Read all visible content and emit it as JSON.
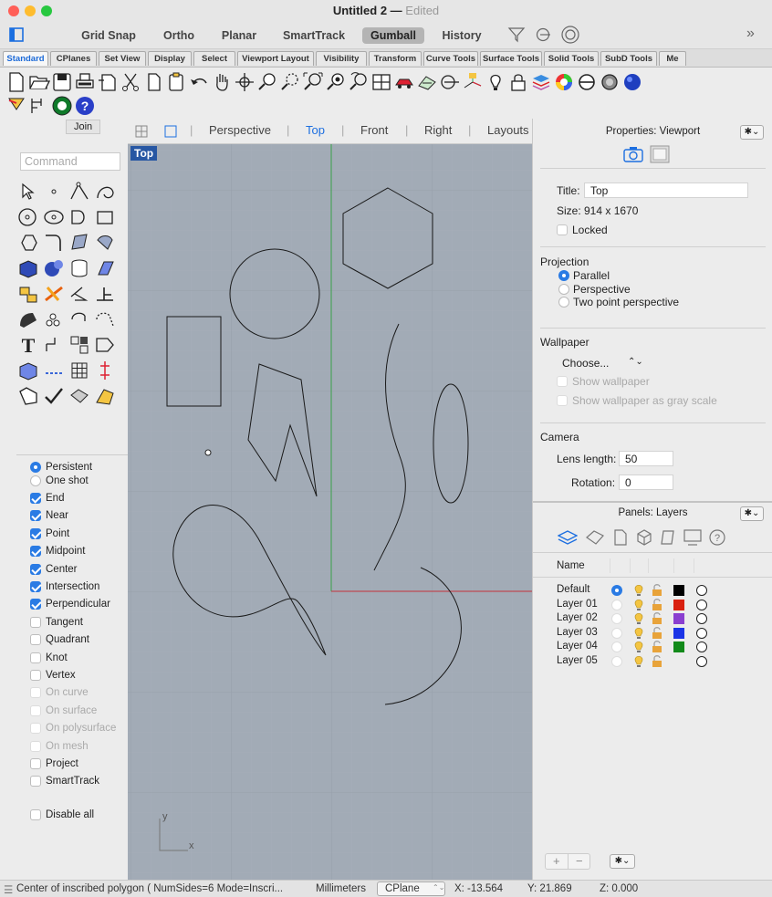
{
  "window": {
    "title": "Untitled 2",
    "edited": "Edited"
  },
  "modes": [
    "Grid Snap",
    "Ortho",
    "Planar",
    "SmartTrack",
    "Gumball",
    "History"
  ],
  "active_mode": "Gumball",
  "toolbar_tabs": [
    "Standard",
    "CPlanes",
    "Set View",
    "Display",
    "Select",
    "Viewport Layout",
    "Visibility",
    "Transform",
    "Curve Tools",
    "Surface Tools",
    "Solid Tools",
    "SubD Tools",
    "Me"
  ],
  "active_tab": "Standard",
  "tooltip": "Join",
  "command": {
    "placeholder": "Command"
  },
  "viewport_tabs": [
    "Perspective",
    "Top",
    "Front",
    "Right",
    "Layouts"
  ],
  "active_viewport": "Top",
  "viewport_label": "Top",
  "axis": {
    "x": "x",
    "y": "y"
  },
  "osnap": {
    "modes": [
      "Persistent",
      "One shot"
    ],
    "items": [
      {
        "label": "End",
        "checked": true,
        "enabled": true
      },
      {
        "label": "Near",
        "checked": true,
        "enabled": true
      },
      {
        "label": "Point",
        "checked": true,
        "enabled": true
      },
      {
        "label": "Midpoint",
        "checked": true,
        "enabled": true
      },
      {
        "label": "Center",
        "checked": true,
        "enabled": true
      },
      {
        "label": "Intersection",
        "checked": true,
        "enabled": true
      },
      {
        "label": "Perpendicular",
        "checked": true,
        "enabled": true
      },
      {
        "label": "Tangent",
        "checked": false,
        "enabled": true
      },
      {
        "label": "Quadrant",
        "checked": false,
        "enabled": true
      },
      {
        "label": "Knot",
        "checked": false,
        "enabled": true
      },
      {
        "label": "Vertex",
        "checked": false,
        "enabled": true
      },
      {
        "label": "On curve",
        "checked": false,
        "enabled": false
      },
      {
        "label": "On surface",
        "checked": false,
        "enabled": false
      },
      {
        "label": "On polysurface",
        "checked": false,
        "enabled": false
      },
      {
        "label": "On mesh",
        "checked": false,
        "enabled": false
      },
      {
        "label": "Project",
        "checked": false,
        "enabled": true
      },
      {
        "label": "SmartTrack",
        "checked": false,
        "enabled": true
      }
    ],
    "disable_all": "Disable all"
  },
  "properties": {
    "header": "Properties: Viewport",
    "title_label": "Title:",
    "title_value": "Top",
    "size": "Size:  914 x 1670",
    "locked": "Locked",
    "projection": "Projection",
    "projections": [
      "Parallel",
      "Perspective",
      "Two point perspective"
    ],
    "wallpaper": "Wallpaper",
    "choose": "Choose...",
    "show_wallpaper": "Show wallpaper",
    "show_gray": "Show wallpaper as gray scale",
    "camera": "Camera",
    "lens_label": "Lens length:",
    "lens_value": "50",
    "rotation_label": "Rotation:",
    "rotation_value": "0"
  },
  "layers": {
    "header": "Panels: Layers",
    "name_col": "Name",
    "rows": [
      {
        "name": "Default",
        "current": true,
        "color": "#000000"
      },
      {
        "name": "Layer 01",
        "current": false,
        "color": "#d9200f"
      },
      {
        "name": "Layer 02",
        "current": false,
        "color": "#8a3fd0"
      },
      {
        "name": "Layer 03",
        "current": false,
        "color": "#1b34e6"
      },
      {
        "name": "Layer 04",
        "current": false,
        "color": "#128a1a"
      },
      {
        "name": "Layer 05",
        "current": false,
        "color": ""
      }
    ]
  },
  "status": {
    "prompt": "Center of inscribed polygon ( NumSides=6 Mode=Inscri...",
    "units": "Millimeters",
    "cplane": "CPlane",
    "x": "X: -13.564",
    "y": "Y: 21.869",
    "z": "Z: 0.000"
  }
}
